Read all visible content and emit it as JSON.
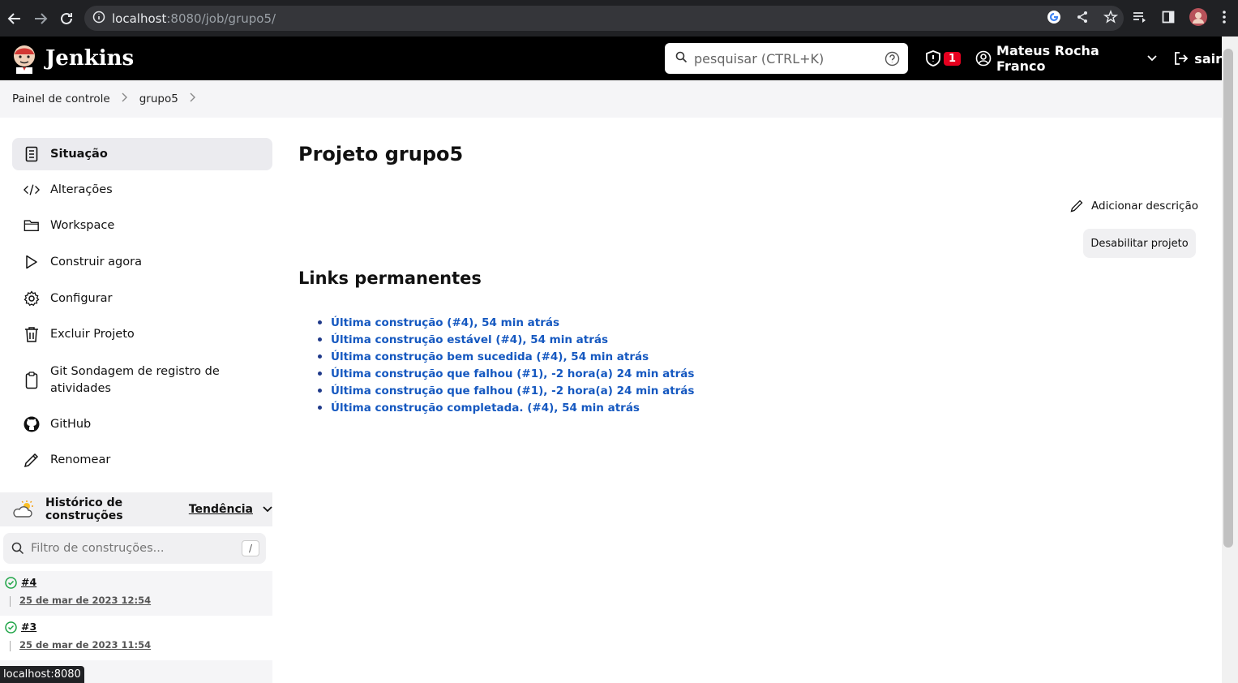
{
  "browser": {
    "url_host": "localhost",
    "url_path": ":8080/job/grupo5/"
  },
  "header": {
    "logo_text": "Jenkins",
    "search_placeholder": "pesquisar (CTRL+K)",
    "security_count": "1",
    "user_name": "Mateus Rocha Franco",
    "logout_label": "sair"
  },
  "breadcrumb": {
    "items": [
      "Painel de controle",
      "grupo5"
    ]
  },
  "sidebar": {
    "items": [
      {
        "label": "Situação",
        "icon": "document-icon"
      },
      {
        "label": "Alterações",
        "icon": "code-icon"
      },
      {
        "label": "Workspace",
        "icon": "folder-icon"
      },
      {
        "label": "Construir agora",
        "icon": "play-icon"
      },
      {
        "label": "Configurar",
        "icon": "gear-icon"
      },
      {
        "label": "Excluir Projeto",
        "icon": "trash-icon"
      },
      {
        "label": "Git Sondagem de registro de atividades",
        "icon": "clipboard-icon"
      },
      {
        "label": "GitHub",
        "icon": "github-icon"
      },
      {
        "label": "Renomear",
        "icon": "pencil-icon"
      }
    ]
  },
  "build_history": {
    "title": "Histórico de construções",
    "trend_label": "Tendência",
    "filter_placeholder": "Filtro de construções...",
    "filter_shortcut": "/",
    "builds": [
      {
        "number": "#4",
        "date": "25 de mar de 2023 12:54"
      },
      {
        "number": "#3",
        "date": "25 de mar de 2023 11:54"
      }
    ]
  },
  "main": {
    "title": "Projeto grupo5",
    "add_description": "Adicionar descrição",
    "disable_button": "Desabilitar projeto",
    "permalinks_title": "Links permanentes",
    "permalinks": [
      "Última construção (#4), 54 min atrás",
      "Última construção estável (#4), 54 min atrás",
      "Última construção bem sucedida (#4), 54 min atrás",
      "Última construção que falhou (#1), -2 hora(a) 24 min atrás",
      "Última construção que falhou (#1), -2 hora(a) 24 min atrás",
      "Última construção completada. (#4), 54 min atrás"
    ]
  },
  "status_tooltip": "localhost:8080",
  "colors": {
    "link": "#1558c0",
    "badge": "#e6001f",
    "success": "#1ea446"
  }
}
